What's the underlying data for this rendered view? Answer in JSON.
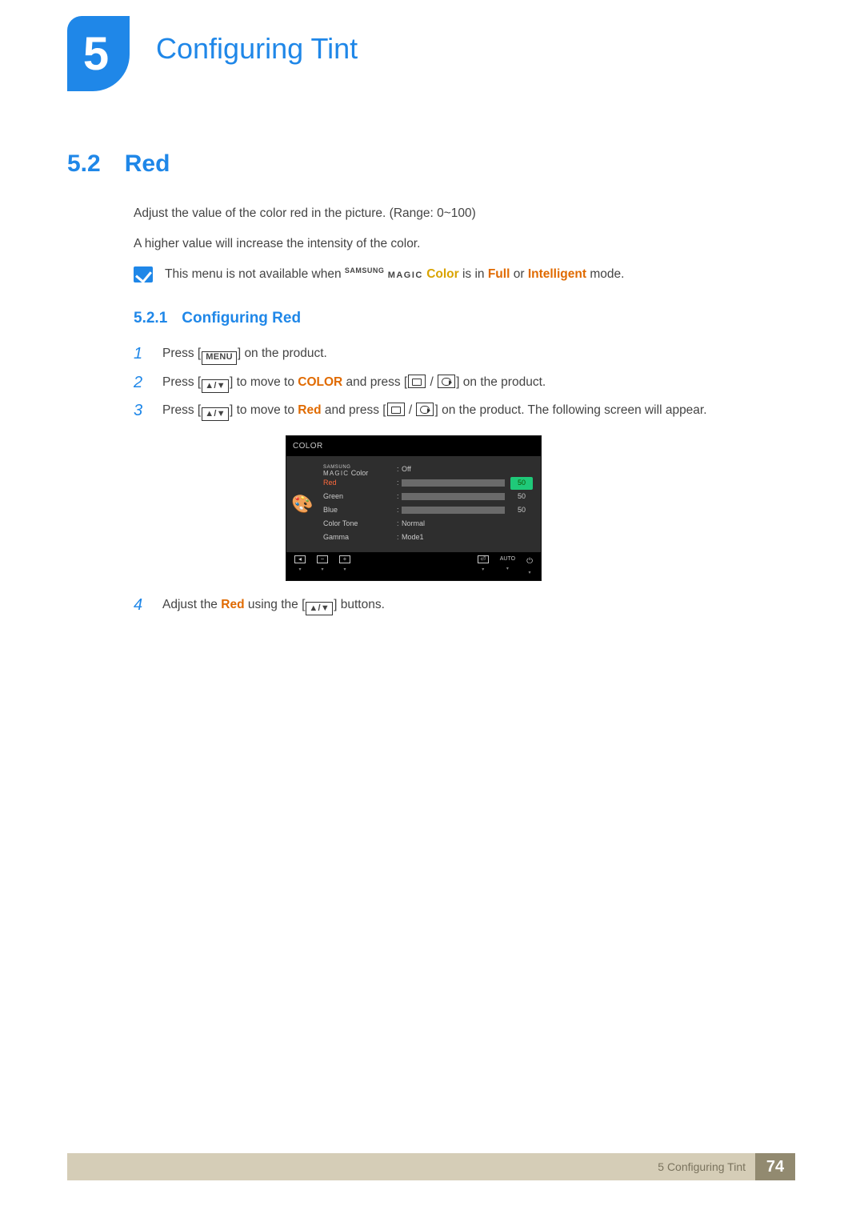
{
  "chapter": {
    "number": "5",
    "title": "Configuring Tint"
  },
  "section": {
    "number": "5.2",
    "title": "Red"
  },
  "para1": "Adjust the value of the color red in the picture. (Range: 0~100)",
  "para2": "A higher value will increase the intensity of the color.",
  "note": {
    "pre": "This menu is not available when ",
    "samsung": "SAMSUNG",
    "magic": "MAGIC",
    "color": "Color",
    "mid1": " is in ",
    "full": "Full",
    "or": " or ",
    "intelligent": "Intelligent",
    "post": " mode."
  },
  "subsection": {
    "number": "5.2.1",
    "title": "Configuring Red"
  },
  "steps": {
    "s1": {
      "n": "1",
      "pre": "Press [",
      "menu": "MENU",
      "post": "] on the product."
    },
    "s2": {
      "n": "2",
      "pre": "Press [",
      "arrows": "▲/▼",
      "mid1": "] to move to ",
      "color": "COLOR",
      "mid2": " and press [",
      "post": "] on the product."
    },
    "s3": {
      "n": "3",
      "pre": "Press [",
      "arrows": "▲/▼",
      "mid1": "] to move to ",
      "red": "Red",
      "mid2": " and press [",
      "post": "] on the product. The following screen will appear."
    },
    "s4": {
      "n": "4",
      "pre": "Adjust the ",
      "red": "Red",
      "mid": " using the [",
      "arrows": "▲/▼",
      "post": "] buttons."
    }
  },
  "osd": {
    "title": "COLOR",
    "rows": {
      "magic": {
        "samsung": "SAMSUNG",
        "magic": "MAGIC",
        "suffix": " Color",
        "value": "Off"
      },
      "red": {
        "label": "Red",
        "value": "50"
      },
      "green": {
        "label": "Green",
        "value": "50"
      },
      "blue": {
        "label": "Blue",
        "value": "50"
      },
      "tone": {
        "label": "Color Tone",
        "value": "Normal"
      },
      "gamma": {
        "label": "Gamma",
        "value": "Mode1"
      }
    },
    "footer": {
      "auto": "AUTO"
    }
  },
  "footer": {
    "label": "5 Configuring Tint",
    "page": "74"
  }
}
